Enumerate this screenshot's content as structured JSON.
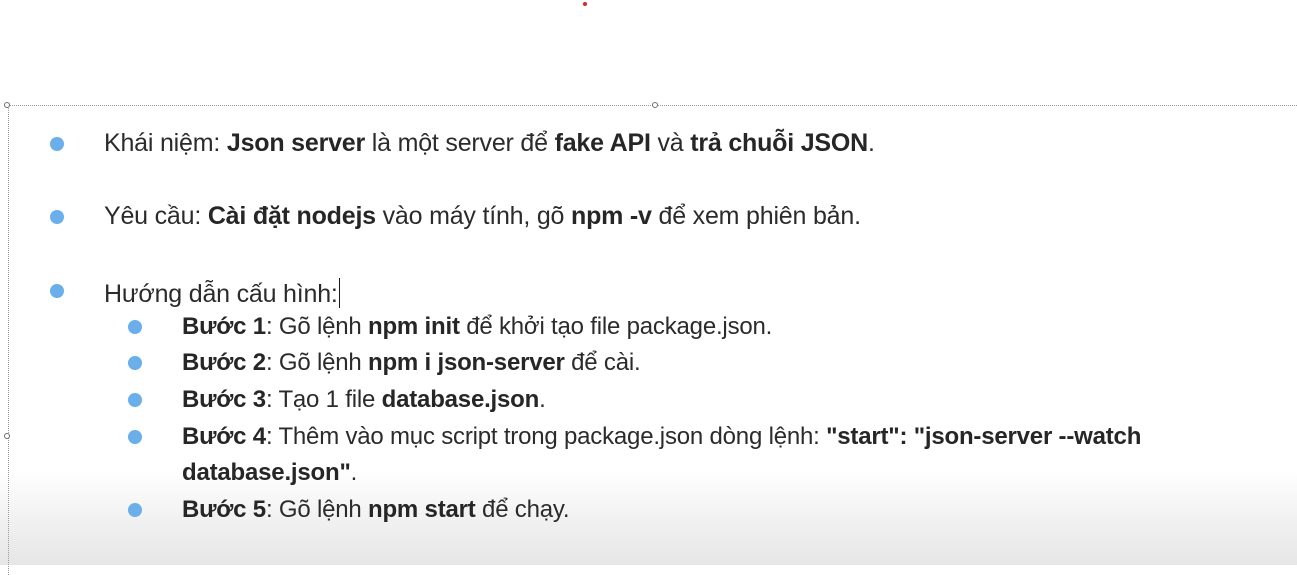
{
  "colors": {
    "bullet": "#6aaeea",
    "red_marker": "#d42a2a"
  },
  "slide": {
    "items": [
      {
        "parts": [
          {
            "text": "Khái niệm: ",
            "bold": false
          },
          {
            "text": "Json server",
            "bold": true
          },
          {
            "text": " là một server để ",
            "bold": false
          },
          {
            "text": "fake API",
            "bold": true
          },
          {
            "text": " và ",
            "bold": false
          },
          {
            "text": "trả chuỗi JSON",
            "bold": true
          },
          {
            "text": ".",
            "bold": false
          }
        ]
      },
      {
        "parts": [
          {
            "text": "Yêu cầu: ",
            "bold": false
          },
          {
            "text": "Cài đặt nodejs",
            "bold": true
          },
          {
            "text": " vào máy tính, gõ ",
            "bold": false
          },
          {
            "text": "npm -v",
            "bold": true
          },
          {
            "text": " để xem phiên bản.",
            "bold": false
          }
        ]
      },
      {
        "parts": [
          {
            "text": "Hướng dẫn cấu hình:",
            "bold": false
          }
        ]
      }
    ],
    "steps": [
      {
        "parts": [
          {
            "text": "Bước 1",
            "bold": true
          },
          {
            "text": ": Gõ lệnh ",
            "bold": false
          },
          {
            "text": "npm init",
            "bold": true
          },
          {
            "text": " để khởi tạo file package.json.",
            "bold": false
          }
        ]
      },
      {
        "parts": [
          {
            "text": "Bước 2",
            "bold": true
          },
          {
            "text": ": Gõ lệnh ",
            "bold": false
          },
          {
            "text": "npm i json-server",
            "bold": true
          },
          {
            "text": " để cài.",
            "bold": false
          }
        ]
      },
      {
        "parts": [
          {
            "text": "Bước 3",
            "bold": true
          },
          {
            "text": ": Tạo 1 file ",
            "bold": false
          },
          {
            "text": "database.json",
            "bold": true
          },
          {
            "text": ".",
            "bold": false
          }
        ]
      },
      {
        "parts": [
          {
            "text": "Bước 4",
            "bold": true
          },
          {
            "text": ": Thêm vào mục script trong package.json dòng lệnh: ",
            "bold": false
          },
          {
            "text": "\"start\": \"json-server --watch",
            "bold": true
          }
        ],
        "continuation": [
          {
            "text": "database.json\"",
            "bold": true
          },
          {
            "text": ".",
            "bold": false
          }
        ]
      },
      {
        "parts": [
          {
            "text": "Bước 5",
            "bold": true
          },
          {
            "text": ": Gõ lệnh ",
            "bold": false
          },
          {
            "text": "npm start",
            "bold": true
          },
          {
            "text": " để chạy.",
            "bold": false
          }
        ]
      }
    ]
  }
}
